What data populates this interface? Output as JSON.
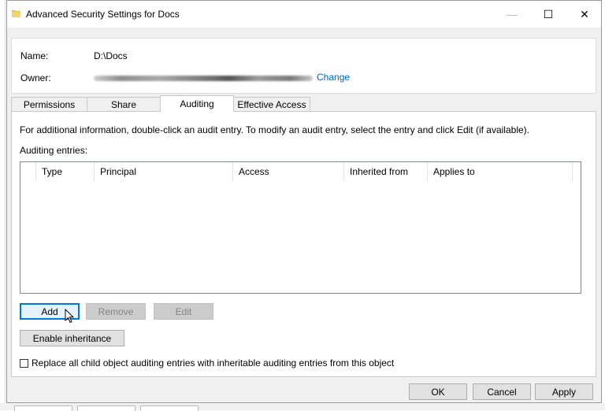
{
  "window": {
    "title": "Advanced Security Settings for Docs",
    "minimize_glyph": "—",
    "maximize_glyph": "☐",
    "close_glyph": "✕"
  },
  "info": {
    "name_label": "Name:",
    "name_value": "D:\\Docs",
    "owner_label": "Owner:",
    "owner_change_link": "Change"
  },
  "tabs": [
    {
      "label": "Permissions",
      "active": false
    },
    {
      "label": "Share",
      "active": false
    },
    {
      "label": "Auditing",
      "active": true
    },
    {
      "label": "Effective Access",
      "active": false
    }
  ],
  "auditing": {
    "description": "For additional information, double-click an audit entry. To modify an audit entry, select the entry and click Edit (if available).",
    "entries_label": "Auditing entries:",
    "columns": [
      "Type",
      "Principal",
      "Access",
      "Inherited from",
      "Applies to"
    ],
    "rows": []
  },
  "buttons": {
    "add": "Add",
    "remove": "Remove",
    "edit": "Edit",
    "enable_inheritance": "Enable inheritance",
    "ok": "OK",
    "cancel": "Cancel",
    "apply": "Apply"
  },
  "replace_checkbox": {
    "label": "Replace all child object auditing entries with inheritable auditing entries from this object",
    "checked": false
  },
  "colors": {
    "link": "#0066cc",
    "focus_border": "#0078d7",
    "folder_icon": "#e8c04a"
  },
  "icons": {
    "title": "folder-icon",
    "cursor": "mouse-pointer-icon"
  }
}
